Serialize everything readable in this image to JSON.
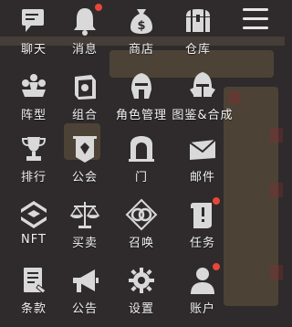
{
  "menu": {
    "items": [
      {
        "label": "聊天",
        "icon": "chat-icon"
      },
      {
        "label": "消息",
        "icon": "bell-icon",
        "badge": true
      },
      {
        "label": "商店",
        "icon": "money-bag-icon"
      },
      {
        "label": "仓库",
        "icon": "treasure-chest-icon"
      },
      {
        "label": "阵型",
        "icon": "formation-icon"
      },
      {
        "label": "组合",
        "icon": "book-icon"
      },
      {
        "label": "角色管理",
        "icon": "helmet-icon"
      },
      {
        "label": "图鉴&合成",
        "icon": "knight-helmet-icon"
      },
      {
        "label": "排行",
        "icon": "trophy-icon"
      },
      {
        "label": "公会",
        "icon": "banner-icon"
      },
      {
        "label": "门",
        "icon": "gate-icon"
      },
      {
        "label": "邮件",
        "icon": "envelope-icon"
      },
      {
        "label": "NFT",
        "icon": "nft-logo-icon"
      },
      {
        "label": "买卖",
        "icon": "scales-icon"
      },
      {
        "label": "召唤",
        "icon": "summon-rings-icon"
      },
      {
        "label": "任务",
        "icon": "quest-scroll-icon",
        "badge": true
      },
      {
        "label": "条款",
        "icon": "document-icon"
      },
      {
        "label": "公告",
        "icon": "megaphone-icon"
      },
      {
        "label": "设置",
        "icon": "gear-icon"
      },
      {
        "label": "账户",
        "icon": "user-icon",
        "badge": true
      }
    ]
  },
  "colors": {
    "background": "#2f2b2c",
    "icon": "#d9d9d9",
    "badge": "#e8463a",
    "label": "#f2f2f2"
  }
}
